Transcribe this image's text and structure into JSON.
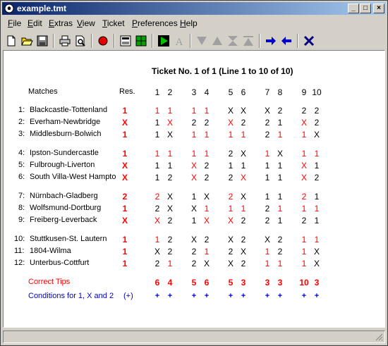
{
  "window": {
    "title": "example.tmt"
  },
  "menu": [
    {
      "first": "F",
      "rest": "ile"
    },
    {
      "first": "E",
      "rest": "dit"
    },
    {
      "first": "E",
      "rest": "xtras"
    },
    {
      "first": "V",
      "rest": "iew"
    },
    {
      "first": "T",
      "rest": "icket"
    },
    {
      "first": "P",
      "rest": "references"
    },
    {
      "first": "H",
      "rest": "elp"
    }
  ],
  "ticket": {
    "heading": "Ticket No. 1 of 1 (Line 1 to 10 of 10)",
    "col_matches": "Matches",
    "col_res": "Res.",
    "line_numbers": [
      "1",
      "2",
      "3",
      "4",
      "5",
      "6",
      "7",
      "8",
      "9",
      "10"
    ],
    "matches": [
      {
        "num": "1:",
        "name": "Blackcastle-Tottenland",
        "res": "1",
        "tips": [
          "1",
          "1",
          "1",
          "1",
          "X",
          "X",
          "X",
          "2",
          "2",
          "2"
        ],
        "hits": [
          1,
          1,
          1,
          1,
          0,
          0,
          0,
          0,
          0,
          0
        ]
      },
      {
        "num": "2:",
        "name": "Everham-Newbridge",
        "res": "X",
        "tips": [
          "1",
          "X",
          "2",
          "2",
          "X",
          "2",
          "2",
          "1",
          "X",
          "2"
        ],
        "hits": [
          0,
          1,
          0,
          0,
          1,
          0,
          0,
          0,
          1,
          0
        ]
      },
      {
        "num": "3:",
        "name": "Middlesburn-Bolwich",
        "res": "1",
        "tips": [
          "1",
          "X",
          "1",
          "1",
          "1",
          "1",
          "2",
          "1",
          "1",
          "X"
        ],
        "hits": [
          0,
          0,
          1,
          1,
          1,
          1,
          0,
          1,
          1,
          0
        ]
      },
      {
        "num": "4:",
        "name": "Ipston-Sundercastle",
        "res": "1",
        "tips": [
          "1",
          "1",
          "1",
          "1",
          "2",
          "X",
          "1",
          "X",
          "1",
          "1"
        ],
        "hits": [
          1,
          1,
          1,
          1,
          0,
          0,
          1,
          0,
          1,
          1
        ]
      },
      {
        "num": "5:",
        "name": "Fulbrough-Liverton",
        "res": "X",
        "tips": [
          "1",
          "1",
          "X",
          "2",
          "1",
          "1",
          "1",
          "1",
          "X",
          "1"
        ],
        "hits": [
          0,
          0,
          1,
          0,
          0,
          0,
          0,
          0,
          1,
          0
        ]
      },
      {
        "num": "6:",
        "name": "South Villa-West Hampto",
        "res": "X",
        "tips": [
          "1",
          "2",
          "X",
          "2",
          "2",
          "X",
          "1",
          "1",
          "X",
          "2"
        ],
        "hits": [
          0,
          0,
          1,
          0,
          0,
          1,
          0,
          0,
          1,
          0
        ]
      },
      {
        "num": "7:",
        "name": "Nürnbach-Gladberg",
        "res": "2",
        "tips": [
          "2",
          "X",
          "1",
          "X",
          "2",
          "X",
          "1",
          "1",
          "2",
          "1"
        ],
        "hits": [
          1,
          0,
          0,
          0,
          1,
          0,
          0,
          0,
          1,
          0
        ]
      },
      {
        "num": "8:",
        "name": "Wolfsmund-Dortburg",
        "res": "1",
        "tips": [
          "2",
          "X",
          "X",
          "1",
          "1",
          "1",
          "2",
          "1",
          "1",
          "1"
        ],
        "hits": [
          0,
          0,
          0,
          1,
          1,
          1,
          0,
          1,
          1,
          1
        ]
      },
      {
        "num": "9:",
        "name": "Freiberg-Leverback",
        "res": "X",
        "tips": [
          "X",
          "2",
          "1",
          "X",
          "X",
          "2",
          "2",
          "1",
          "2",
          "1"
        ],
        "hits": [
          1,
          0,
          0,
          1,
          1,
          0,
          0,
          0,
          0,
          0
        ]
      },
      {
        "num": "10:",
        "name": "Stuttkusen-St. Lautern",
        "res": "1",
        "tips": [
          "1",
          "2",
          "X",
          "2",
          "X",
          "2",
          "X",
          "2",
          "1",
          "1"
        ],
        "hits": [
          1,
          0,
          0,
          0,
          0,
          0,
          0,
          0,
          1,
          1
        ]
      },
      {
        "num": "11:",
        "name": "1804-Wilma",
        "res": "1",
        "tips": [
          "X",
          "2",
          "2",
          "1",
          "2",
          "X",
          "1",
          "2",
          "1",
          "X"
        ],
        "hits": [
          0,
          0,
          0,
          1,
          0,
          0,
          1,
          0,
          1,
          0
        ]
      },
      {
        "num": "12:",
        "name": "Unterbus-Cottfurt",
        "res": "1",
        "tips": [
          "2",
          "1",
          "2",
          "X",
          "X",
          "2",
          "1",
          "1",
          "1",
          "X"
        ],
        "hits": [
          0,
          1,
          0,
          0,
          0,
          0,
          1,
          1,
          1,
          0
        ]
      }
    ],
    "correct_tips_label": "Correct Tips",
    "correct_tips": [
      "6",
      "4",
      "5",
      "6",
      "5",
      "3",
      "3",
      "3",
      "10",
      "3"
    ],
    "conditions_label": "Conditions for 1, X and 2",
    "conditions_res": "(+)",
    "conditions": [
      "+",
      "+",
      "+",
      "+",
      "+",
      "+",
      "+",
      "+",
      "+",
      "+"
    ]
  },
  "colors": {
    "hit": "#ff0000",
    "title_start": "#0a246a",
    "title_end": "#a6caf0",
    "conditions": "#0000cc"
  }
}
